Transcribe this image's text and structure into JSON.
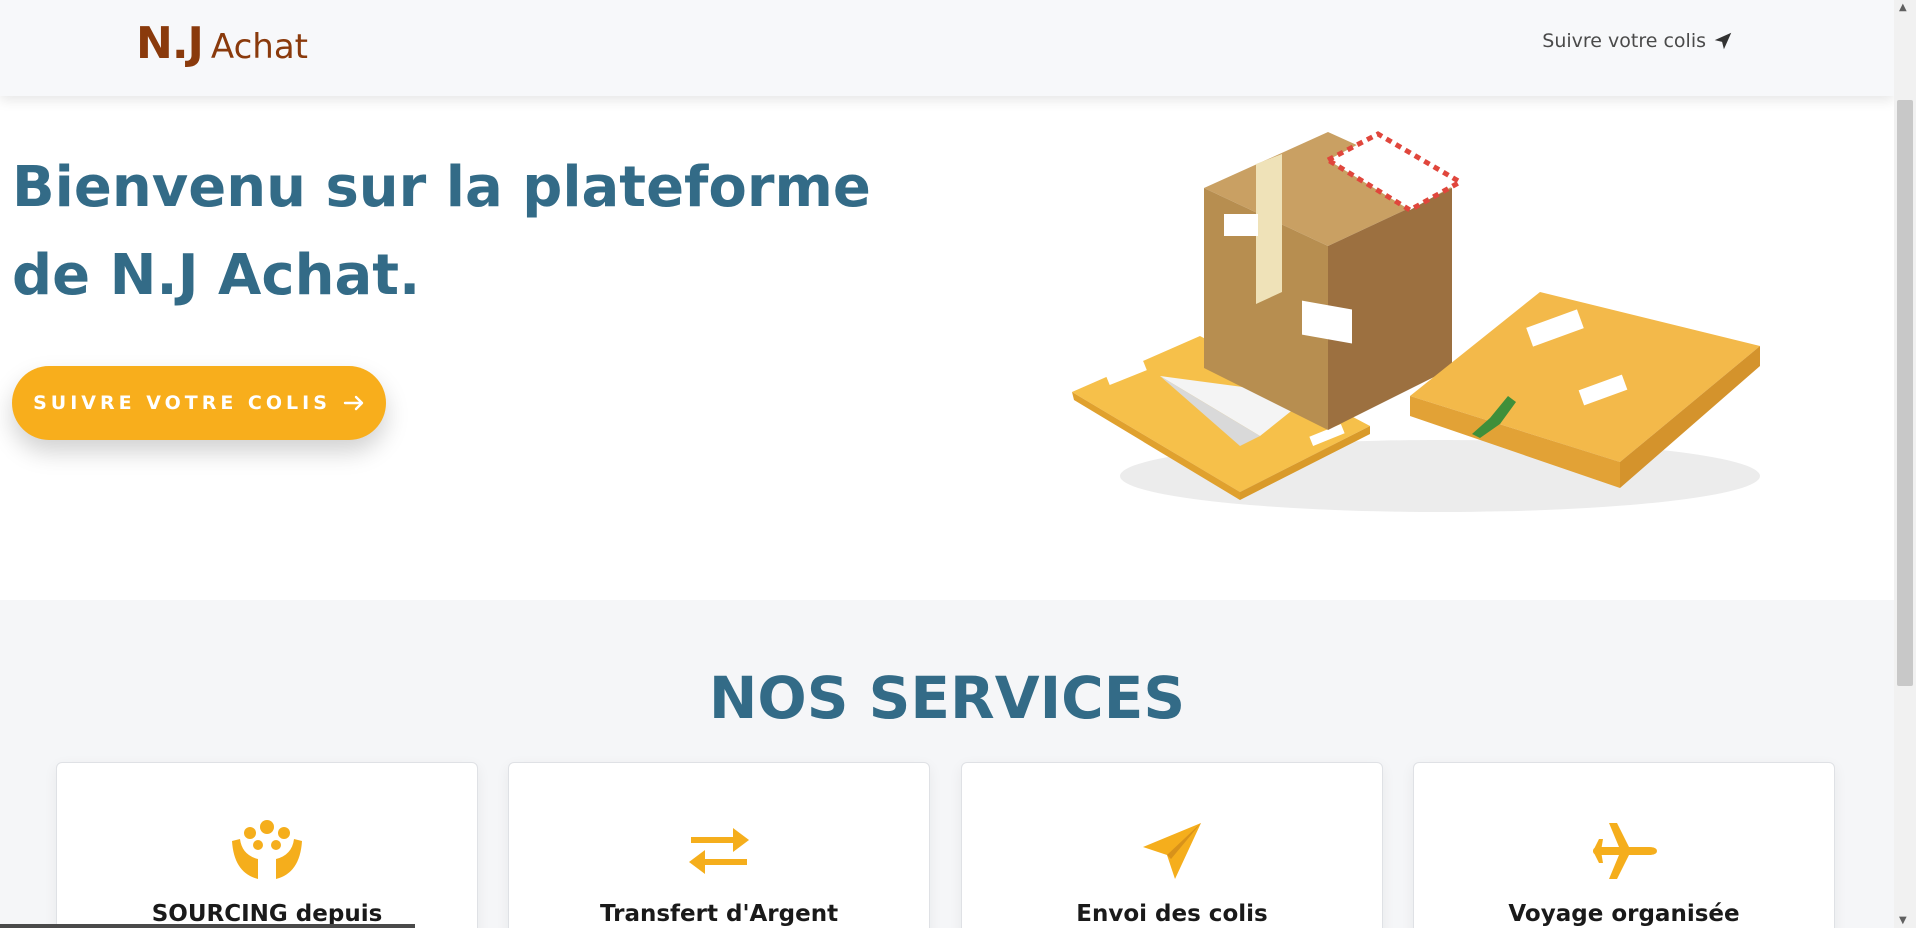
{
  "header": {
    "logo_nj": "N.J",
    "logo_achat": "Achat",
    "track_link": "Suivre votre colis",
    "track_icon": "paper-plane-icon"
  },
  "hero": {
    "title": "Bienvenu sur la plateforme de N.J Achat.",
    "button_label": "SUIVRE VOTRE COLIS",
    "button_icon": "arrow-right-icon",
    "illustration": "parcels-illustration"
  },
  "services": {
    "title": "NOS SERVICES",
    "items": [
      {
        "label": "SOURCING depuis",
        "icon": "people-group-icon"
      },
      {
        "label": "Transfert d'Argent",
        "icon": "exchange-arrows-icon"
      },
      {
        "label": "Envoi des colis",
        "icon": "paper-plane-icon"
      },
      {
        "label": "Voyage organisée",
        "icon": "airplane-icon"
      }
    ]
  },
  "colors": {
    "brand": "#8a3a0c",
    "heading": "#336b87",
    "accent": "#f8ae1c"
  }
}
